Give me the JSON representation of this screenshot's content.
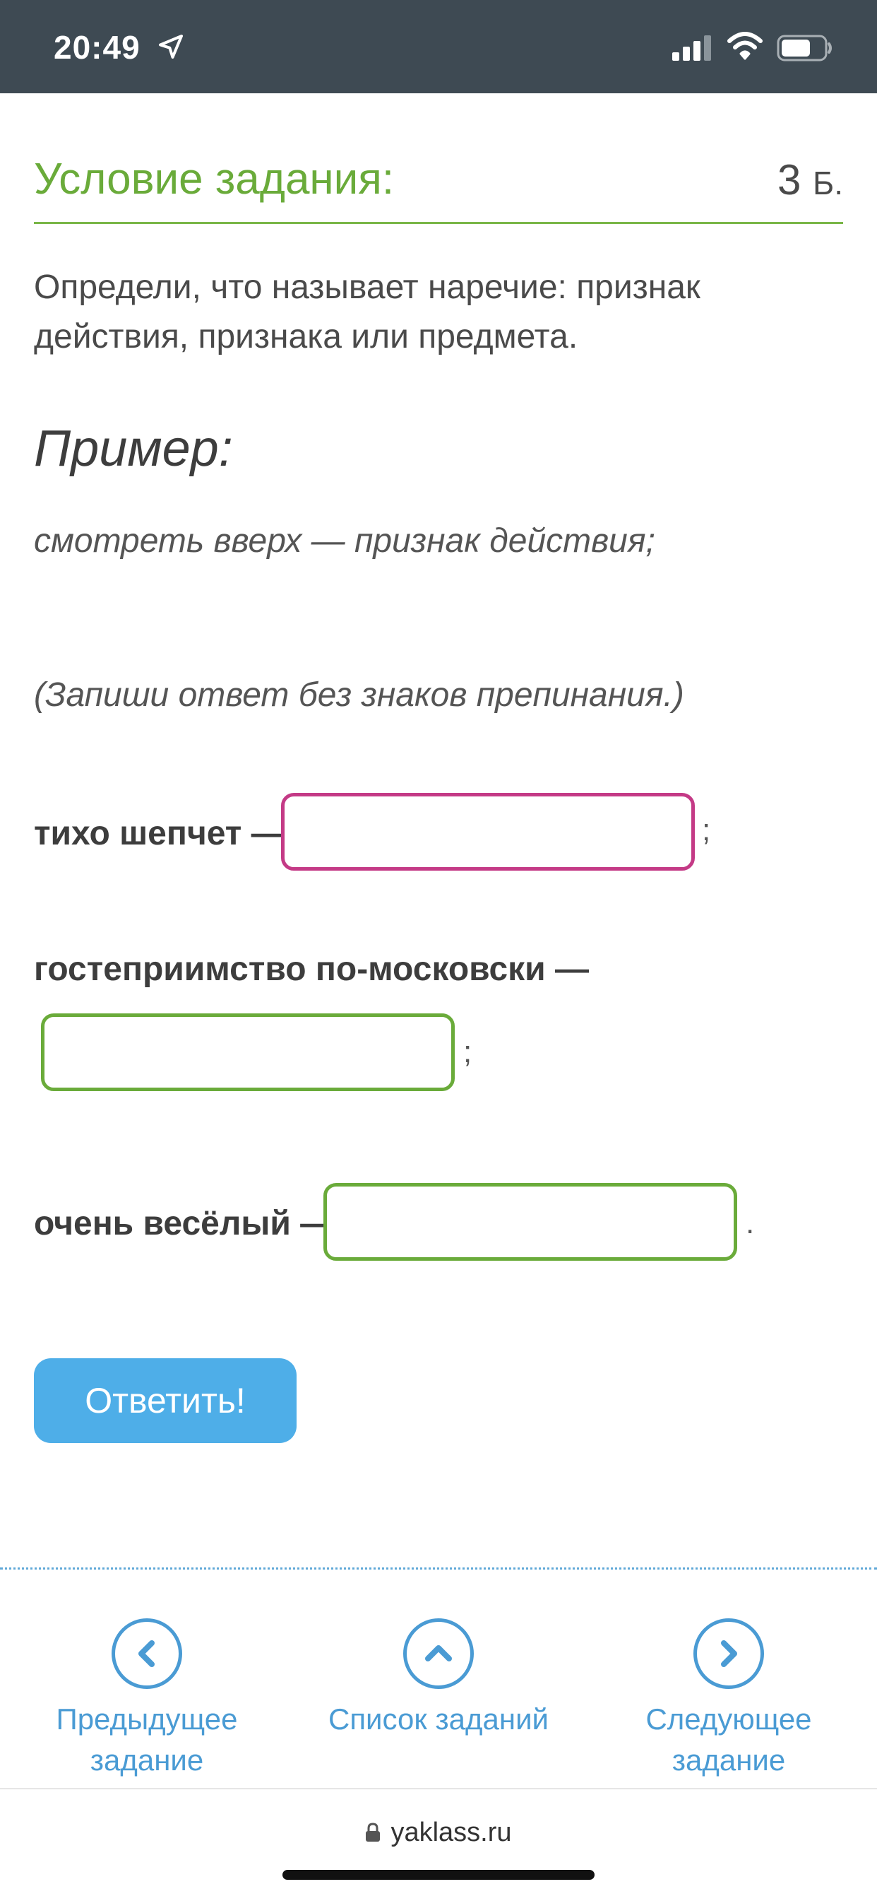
{
  "status_bar": {
    "time": "20:49",
    "icons": [
      "location-arrow-icon",
      "cellular-signal-icon",
      "wifi-icon",
      "battery-icon"
    ]
  },
  "task": {
    "title": "Условие задания:",
    "points_value": "3",
    "points_unit": "Б.",
    "question": "Определи, что называет наречие: признак действия, признака или предмета.",
    "example_title": "Пример:",
    "example_text": "смотреть вверх — признак действия;",
    "note": "(Запиши ответ без знаков препинания.)"
  },
  "items": [
    {
      "label": "тихо шепчет —",
      "value": "",
      "end": ";"
    },
    {
      "label": "гостеприимство по-московски —",
      "value": "",
      "end": ";"
    },
    {
      "label": "очень весёлый —",
      "value": "",
      "end": "."
    }
  ],
  "submit_label": "Ответить!",
  "nav": {
    "prev_label_line1": "Предыдущее",
    "prev_label_line2": "задание",
    "list_label": "Список заданий",
    "next_label_line1": "Следующее",
    "next_label_line2": "задание"
  },
  "browser": {
    "url": "yaklass.ru"
  },
  "colors": {
    "status_bar_bg": "#3e4a53",
    "title_green": "#6aab3a",
    "input_active_border": "#c43a86",
    "input_border": "#6aab3a",
    "button_blue": "#4eaee8",
    "nav_blue": "#4a9bd4"
  }
}
